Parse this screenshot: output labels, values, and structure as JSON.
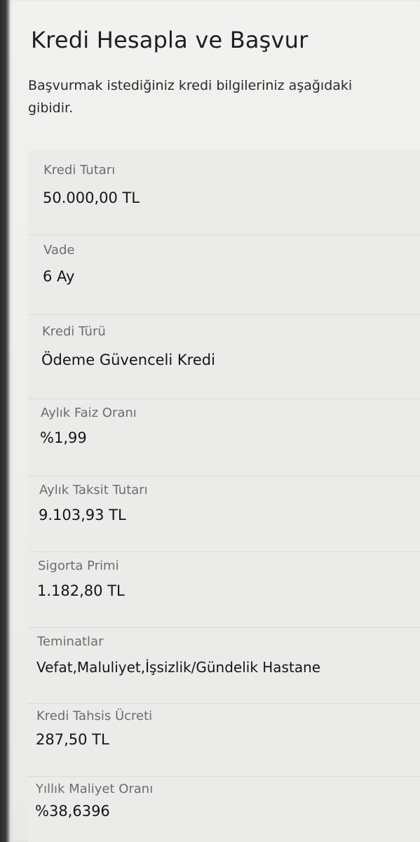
{
  "page": {
    "title": "Kredi Hesapla ve Başvur",
    "intro_line1": "Başvurmak istediğiniz kredi bilgileriniz aşağıdaki",
    "intro_line2": "gibidir."
  },
  "details": [
    {
      "label": "Kredi Tutarı",
      "value": "50.000,00 TL"
    },
    {
      "label": "Vade",
      "value": "6 Ay"
    },
    {
      "label": "Kredi Türü",
      "value": "Ödeme Güvenceli Kredi"
    },
    {
      "label": "Aylık Faiz Oranı",
      "value": "%1,99"
    },
    {
      "label": "Aylık Taksit Tutarı",
      "value": "9.103,93 TL"
    },
    {
      "label": "Sigorta Primi",
      "value": "1.182,80 TL"
    },
    {
      "label": "Teminatlar",
      "value": "Vefat,Maluliyet,İşsizlik/Gündelik Hastane"
    },
    {
      "label": "Kredi Tahsis Ücreti",
      "value": "287,50 TL"
    },
    {
      "label": "Yıllık Maliyet Oranı",
      "value": "%38,6396"
    }
  ]
}
